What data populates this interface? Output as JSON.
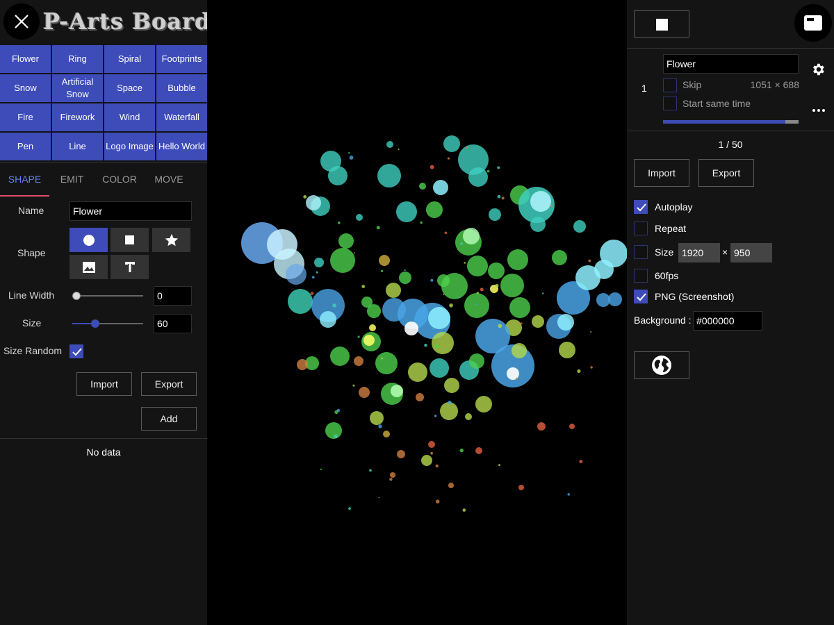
{
  "app": {
    "title": "P-Arts Board"
  },
  "presets": [
    "Flower",
    "Ring",
    "Spiral",
    "Footprints",
    "Snow",
    "Artificial Snow",
    "Space",
    "Bubble",
    "Fire",
    "Firework",
    "Wind",
    "Waterfall",
    "Pen",
    "Line",
    "Logo Image",
    "Hello World"
  ],
  "tabs": [
    "SHAPE",
    "EMIT",
    "COLOR",
    "MOVE"
  ],
  "active_tab": "SHAPE",
  "shape_form": {
    "name_label": "Name",
    "name_value": "Flower",
    "shape_label": "Shape",
    "shape_options": [
      "circle",
      "square",
      "star",
      "image",
      "text"
    ],
    "selected_shape": "circle",
    "line_width_label": "Line Width",
    "line_width_value": "0",
    "line_width_level": 0,
    "size_label": "Size",
    "size_value": "60",
    "size_level": 0.3,
    "size_random_label": "Size Random",
    "size_random_checked": true,
    "import_label": "Import",
    "export_label": "Export",
    "add_label": "Add",
    "no_data_text": "No data"
  },
  "layer": {
    "index": "1",
    "name": "Flower",
    "skip_label": "Skip",
    "skip_checked": false,
    "dimensions": "1051 × 688",
    "start_same_time_label": "Start same time",
    "start_same_time_checked": false,
    "progress": 0.9
  },
  "playback": {
    "page_counter": "1 / 50",
    "import_label": "Import",
    "export_label": "Export",
    "autoplay_label": "Autoplay",
    "autoplay_checked": true,
    "repeat_label": "Repeat",
    "repeat_checked": false,
    "size_label": "Size",
    "size_checked": false,
    "width_value": "1920",
    "size_separator": "×",
    "height_value": "950",
    "fps60_label": "60fps",
    "fps60_checked": false,
    "png_label": "PNG (Screenshot)",
    "png_checked": true,
    "background_label": "Background :",
    "background_value": "#000000"
  },
  "colors": {
    "accent": "#3d4cb9",
    "tab_active": "#6b7cf0",
    "tab_underline": "#e24d6b",
    "panel_bg": "#141414",
    "canvas_bg": "#000000"
  },
  "icons": {
    "close": "close-icon",
    "stop": "stop-icon",
    "panel": "panel-toggle-icon",
    "settings": "gear-icon",
    "more": "more-horizontal-icon",
    "globe": "globe-icon"
  }
}
